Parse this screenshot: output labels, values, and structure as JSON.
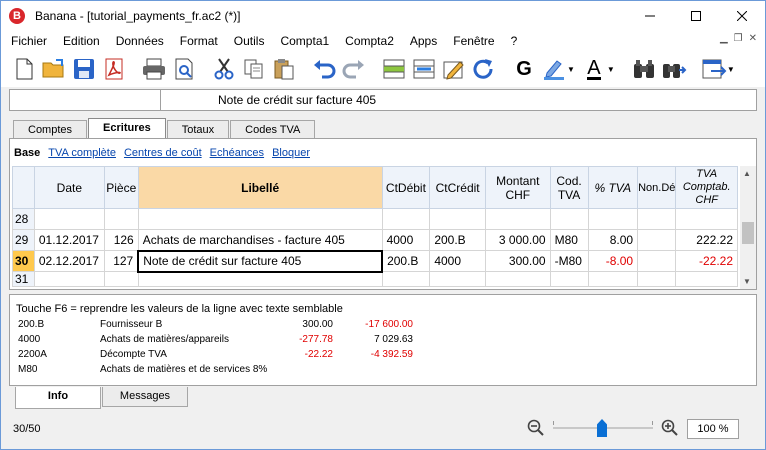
{
  "window": {
    "title": "Banana - [tutorial_payments_fr.ac2 (*)]",
    "app_icon_letter": "B",
    "minimize_icon": "minimize-icon",
    "maximize_icon": "maximize-icon",
    "close_icon": "close-icon"
  },
  "menu": [
    "Fichier",
    "Edition",
    "Données",
    "Format",
    "Outils",
    "Compta1",
    "Compta2",
    "Apps",
    "Fenêtre",
    "?"
  ],
  "toolbar_icons": [
    "new-document-icon",
    "open-folder-icon",
    "save-icon",
    "pdf-icon",
    "print-icon",
    "print-preview-icon",
    "cut-icon",
    "copy-icon",
    "paste-icon",
    "undo-icon",
    "redo-icon",
    "insert-row-icon",
    "delete-row-icon",
    "edit-icon",
    "refresh-icon",
    "bold-icon",
    "highlight-color-icon",
    "font-color-icon",
    "find-icon",
    "find-next-icon",
    "export-icon"
  ],
  "bold_label": "G",
  "font_color_label": "A",
  "cell_editor": {
    "address": "",
    "content": "Note de crédit sur facture 405"
  },
  "tabs": [
    {
      "label": "Comptes",
      "active": false
    },
    {
      "label": "Ecritures",
      "active": true
    },
    {
      "label": "Totaux",
      "active": false
    },
    {
      "label": "Codes TVA",
      "active": false
    }
  ],
  "views": [
    {
      "label": "Base",
      "active": true
    },
    {
      "label": "TVA complète",
      "active": false
    },
    {
      "label": "Centres de coût",
      "active": false
    },
    {
      "label": "Echéances",
      "active": false
    },
    {
      "label": "Bloquer",
      "active": false
    }
  ],
  "columns": [
    {
      "label": "Date"
    },
    {
      "label": "Pièce"
    },
    {
      "label": "Libellé"
    },
    {
      "label": "CtDébit"
    },
    {
      "label": "CtCrédit"
    },
    {
      "label": "Montant\nCHF"
    },
    {
      "label": "Cod.\nTVA"
    },
    {
      "label": "% TVA"
    },
    {
      "label": "Non.Dé"
    },
    {
      "label": "TVA\nComptab.\nCHF"
    }
  ],
  "rows": [
    {
      "num": "28",
      "date": "",
      "piece": "",
      "libelle": "",
      "debit": "",
      "credit": "",
      "montant": "",
      "code": "",
      "pct": "",
      "nonded": "",
      "tva": ""
    },
    {
      "num": "29",
      "date": "01.12.2017",
      "piece": "126",
      "libelle": "Achats de marchandises - facture 405",
      "debit": "4000",
      "credit": "200.B",
      "montant": "3 000.00",
      "code": "M80",
      "pct": "8.00",
      "nonded": "",
      "tva": "222.22"
    },
    {
      "num": "30",
      "date": "02.12.2017",
      "piece": "127",
      "libelle": "Note de crédit sur facture 405",
      "debit": "200.B",
      "credit": "4000",
      "montant": "300.00",
      "code": "-M80",
      "pct": "-8.00",
      "nonded": "",
      "tva": "-22.22"
    },
    {
      "num": "31",
      "date": "",
      "piece": "",
      "libelle": "",
      "debit": "",
      "credit": "",
      "montant": "",
      "code": "",
      "pct": "",
      "nonded": "",
      "tva": ""
    }
  ],
  "info": {
    "hint": "Touche F6 = reprendre les valeurs de la ligne avec texte semblable",
    "lines": [
      {
        "code": "200.B",
        "desc": "Fournisseur B",
        "v1": "300.00",
        "v2": "-17 600.00"
      },
      {
        "code": "4000",
        "desc": "Achats de matières/appareils",
        "v1": "-277.78",
        "v2": "7 029.63"
      },
      {
        "code": "2200A",
        "desc": "Décompte TVA",
        "v1": "-22.22",
        "v2": "-4 392.59"
      },
      {
        "code": "M80",
        "desc": "Achats de matières et de services 8%",
        "v1": "",
        "v2": ""
      }
    ]
  },
  "bottom_tabs": [
    {
      "label": "Info",
      "active": true
    },
    {
      "label": "Messages",
      "active": false
    }
  ],
  "status": {
    "position": "30/50",
    "zoom": "100 %",
    "zoom_level_percent": 100
  },
  "colors": {
    "accent": "#0a6fd4",
    "header_bg": "#eef3fa",
    "libelle_header": "#fad9a6",
    "current_row": "#ffc94d",
    "negative": "#e00000"
  }
}
